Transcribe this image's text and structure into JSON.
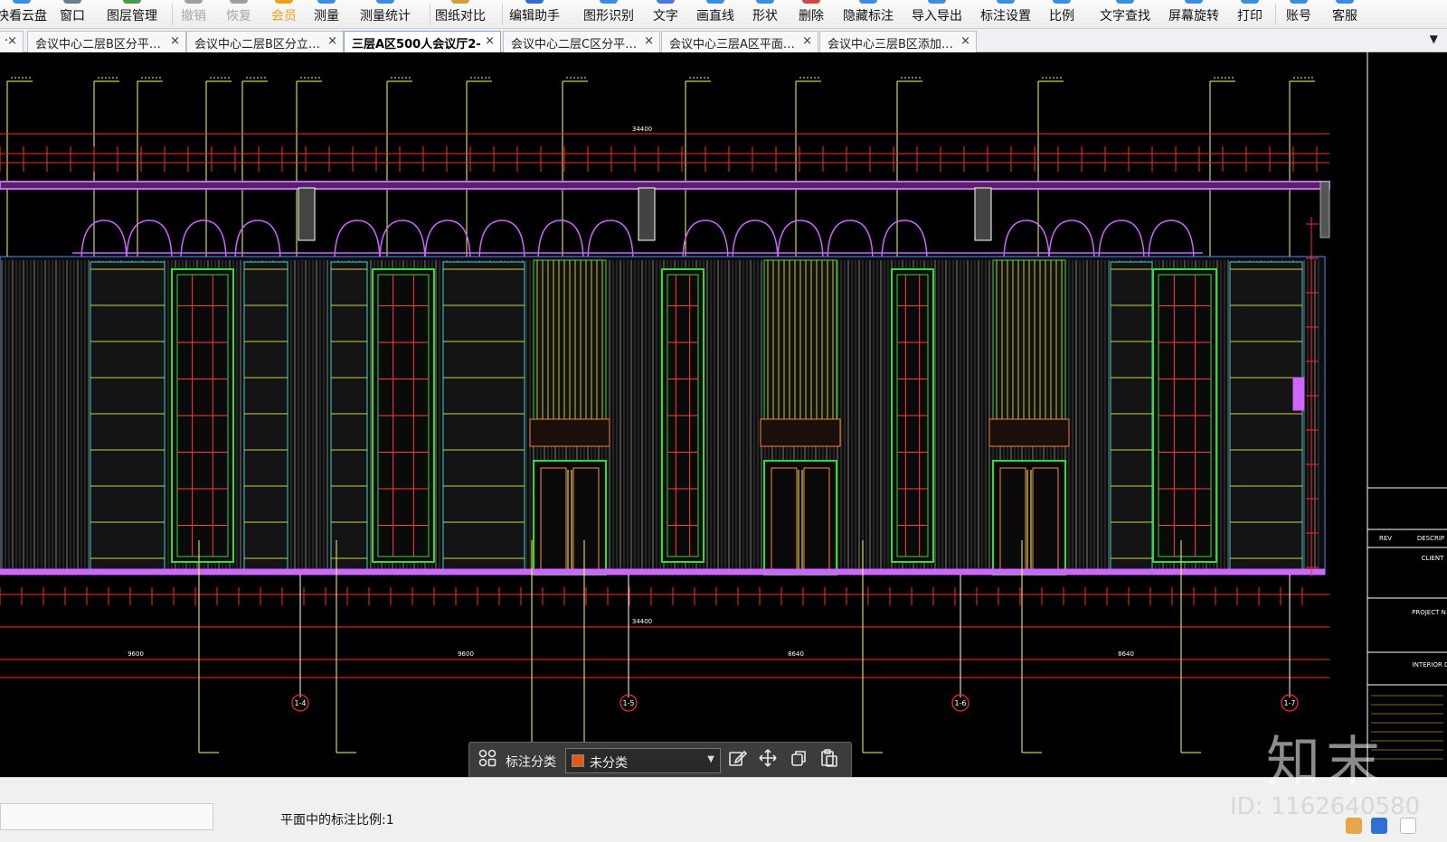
{
  "toolbar": {
    "items": [
      {
        "label": "快看云盘",
        "state": "normal"
      },
      {
        "label": "窗口",
        "state": "normal"
      },
      {
        "label": "图层管理",
        "state": "normal"
      },
      {
        "label": "撤销",
        "state": "disabled"
      },
      {
        "label": "恢复",
        "state": "disabled"
      },
      {
        "label": "会员",
        "state": "vip"
      },
      {
        "label": "测量",
        "state": "normal"
      },
      {
        "label": "测量统计",
        "state": "normal"
      },
      {
        "label": "图纸对比",
        "state": "normal"
      },
      {
        "label": "编辑助手",
        "state": "normal"
      },
      {
        "label": "图形识别",
        "state": "normal"
      },
      {
        "label": "文字",
        "state": "normal"
      },
      {
        "label": "画直线",
        "state": "normal"
      },
      {
        "label": "形状",
        "state": "normal"
      },
      {
        "label": "删除",
        "state": "normal"
      },
      {
        "label": "隐藏标注",
        "state": "normal"
      },
      {
        "label": "导入导出",
        "state": "normal"
      },
      {
        "label": "标注设置",
        "state": "normal"
      },
      {
        "label": "比例",
        "state": "normal"
      },
      {
        "label": "文字查找",
        "state": "normal"
      },
      {
        "label": "屏幕旋转",
        "state": "normal"
      },
      {
        "label": "打印",
        "state": "normal"
      },
      {
        "label": "账号",
        "state": "normal"
      },
      {
        "label": "客服",
        "state": "normal"
      }
    ]
  },
  "tabs": [
    {
      "label": "·",
      "active": false
    },
    {
      "label": "会议中心二层B区分平…",
      "active": false
    },
    {
      "label": "会议中心二层B区分立…",
      "active": false
    },
    {
      "label": "三层A区500人会议厅2-",
      "active": true
    },
    {
      "label": "会议中心二层C区分平…",
      "active": false
    },
    {
      "label": "会议中心三层A区平面…",
      "active": false
    },
    {
      "label": "会议中心三层B区添加…",
      "active": false
    }
  ],
  "tab_close_glyph": "×",
  "tab_overflow_glyph": "▼",
  "drawing": {
    "total_dim": "34400",
    "bottom_total": "34400",
    "segment_dims": [
      "9600",
      "9600",
      "8640",
      "8640"
    ],
    "axis_labels": [
      "1-4",
      "1-5",
      "1-6",
      "1-7"
    ],
    "title_block": {
      "rev_label": "REV",
      "desc_label": "DESCRIP",
      "client_label": "CLIENT",
      "project_label": "PROJECT N",
      "interior_label": "INTERIOR D"
    }
  },
  "float_bar": {
    "label": "标注分类",
    "select_value": "未分类",
    "swatch_color": "#e05a1a"
  },
  "status": {
    "scale_text": "平面中的标注比例:1"
  },
  "watermark": {
    "logo": "知末",
    "id_text": "ID: 1162640580"
  }
}
